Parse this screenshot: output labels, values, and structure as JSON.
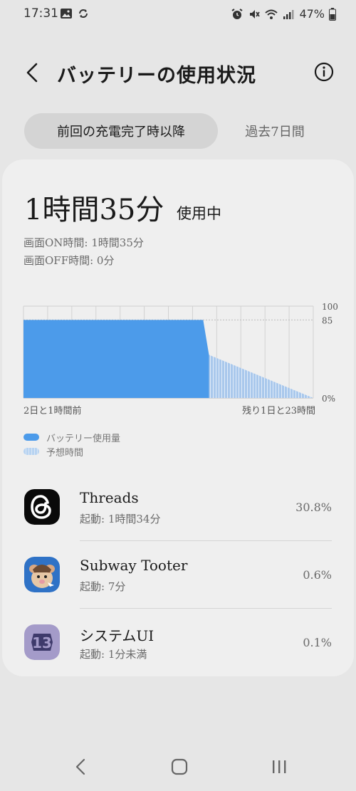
{
  "status_bar": {
    "time": "17:31",
    "battery_percent": "47%"
  },
  "header": {
    "title": "バッテリーの使用状況"
  },
  "tabs": [
    {
      "label": "前回の充電完了時以降",
      "active": true
    },
    {
      "label": "過去7日間",
      "active": false
    }
  ],
  "usage": {
    "total": "1時間35分",
    "suffix": "使用中",
    "screen_on": "画面ON時間: 1時間35分",
    "screen_off": "画面OFF時間: 0分"
  },
  "chart_data": {
    "type": "area",
    "y_ticks": [
      "100",
      "85",
      "0%"
    ],
    "ylim": [
      0,
      100
    ],
    "x_start_label": "2日と1時間前",
    "x_end_label": "残り1日と23時間",
    "series": [
      {
        "name": "バッテリー使用量",
        "color": "#4c9bea",
        "points": [
          [
            0,
            85
          ],
          [
            0.62,
            85
          ],
          [
            0.64,
            47
          ]
        ]
      },
      {
        "name": "予想時間",
        "color": "#a9c8ec",
        "points": [
          [
            0.64,
            47
          ],
          [
            1.0,
            0
          ]
        ]
      }
    ],
    "grid": true
  },
  "legend": [
    {
      "label": "バッテリー使用量",
      "color": "#4c9bea"
    },
    {
      "label": "予想時間",
      "color": "#b7d3f1"
    }
  ],
  "apps": [
    {
      "name": "Threads",
      "sub": "起動: 1時間34分",
      "percent": "30.8%",
      "icon": "threads-icon"
    },
    {
      "name": "Subway Tooter",
      "sub": "起動: 7分",
      "percent": "0.6%",
      "icon": "subway-tooter-icon"
    },
    {
      "name": "システムUI",
      "sub": "起動: 1分未満",
      "percent": "0.1%",
      "icon": "system-ui-icon"
    }
  ]
}
